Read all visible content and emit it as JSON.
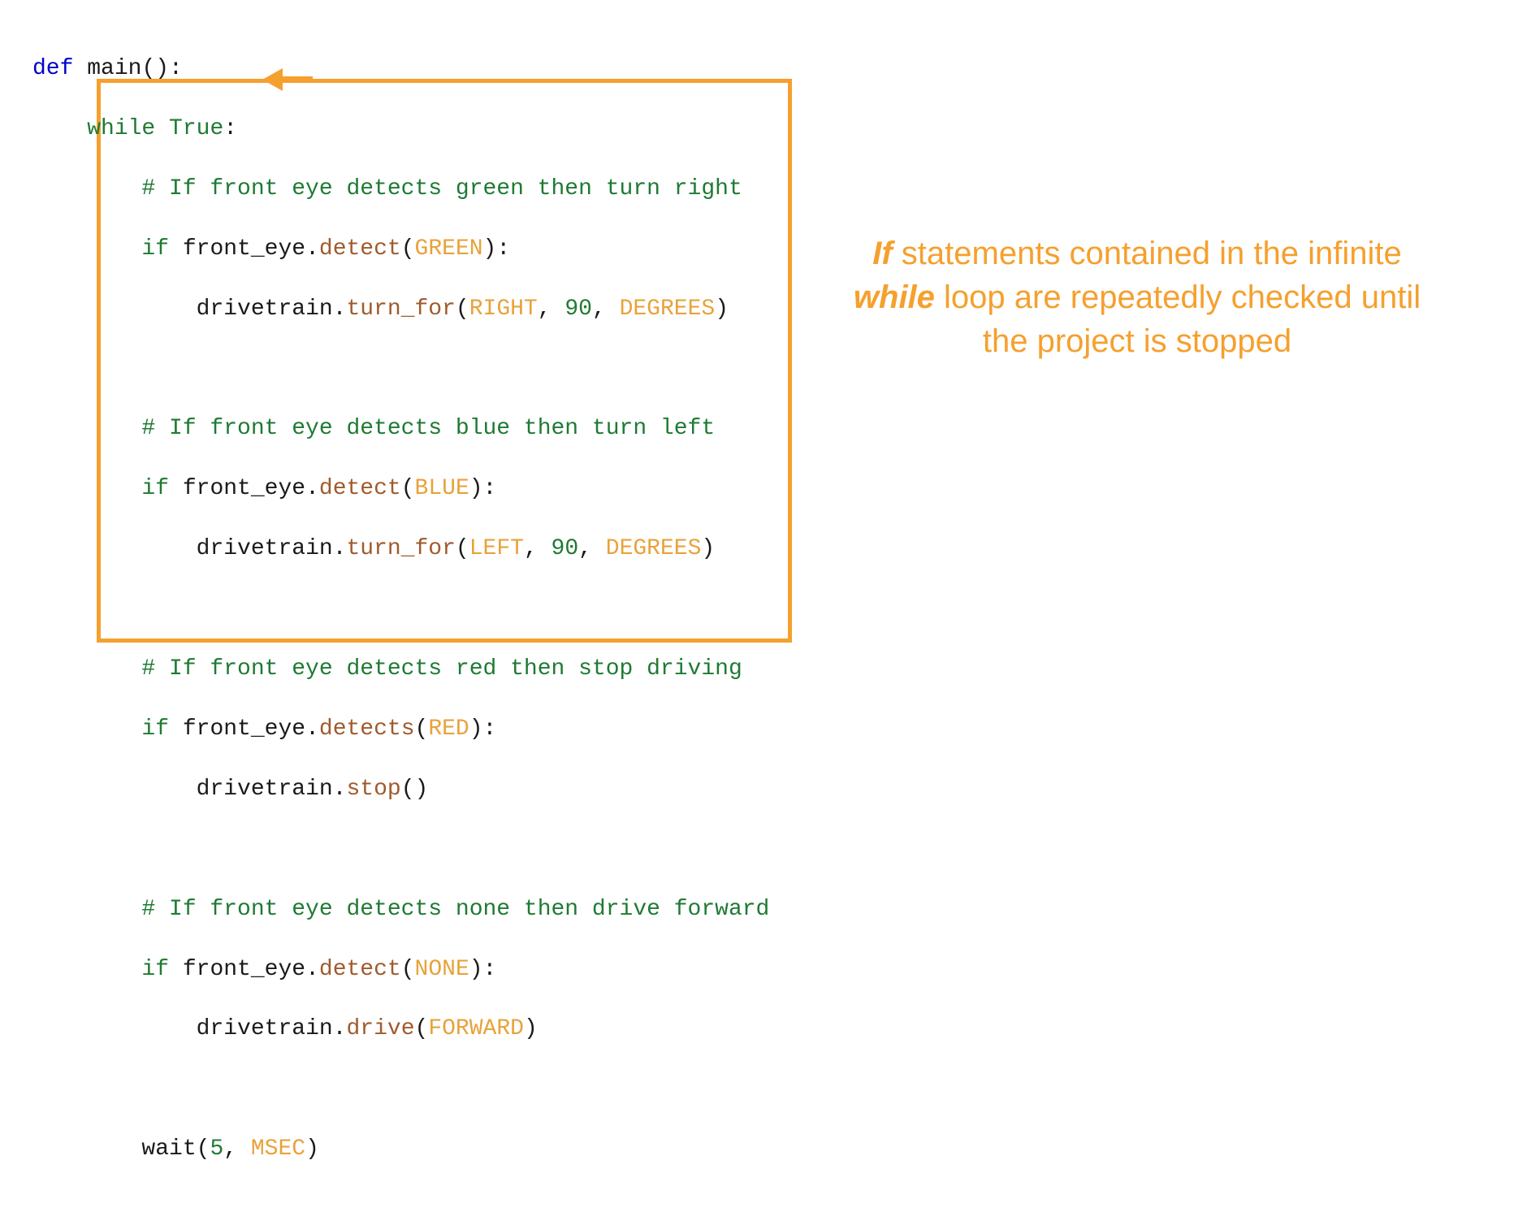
{
  "code": {
    "line_def": {
      "kw": "def",
      "name": "main",
      "parens": "():",
      "space": " "
    },
    "line_while": {
      "kw": "while",
      "true": "True",
      "colon": ":"
    },
    "comment_green": "# If front eye detects green then turn right",
    "if_green": {
      "kw": "if",
      "obj": "front_eye",
      "dot": ".",
      "method": "detect",
      "open": "(",
      "arg": "GREEN",
      "close": "):"
    },
    "turn_right": {
      "obj": "drivetrain",
      "dot": ".",
      "method": "turn_for",
      "open": "(",
      "a1": "RIGHT",
      "c1": ", ",
      "a2": "90",
      "c2": ", ",
      "a3": "DEGREES",
      "close": ")"
    },
    "comment_blue": "# If front eye detects blue then turn left",
    "if_blue": {
      "kw": "if",
      "obj": "front_eye",
      "dot": ".",
      "method": "detect",
      "open": "(",
      "arg": "BLUE",
      "close": "):"
    },
    "turn_left": {
      "obj": "drivetrain",
      "dot": ".",
      "method": "turn_for",
      "open": "(",
      "a1": "LEFT",
      "c1": ", ",
      "a2": "90",
      "c2": ", ",
      "a3": "DEGREES",
      "close": ")"
    },
    "comment_red": "# If front eye detects red then stop driving",
    "if_red": {
      "kw": "if",
      "obj": "front_eye",
      "dot": ".",
      "method": "detects",
      "open": "(",
      "arg": "RED",
      "close": "):"
    },
    "stop": {
      "obj": "drivetrain",
      "dot": ".",
      "method": "stop",
      "parens": "()"
    },
    "comment_none": "# If front eye detects none then drive forward",
    "if_none": {
      "kw": "if",
      "obj": "front_eye",
      "dot": ".",
      "method": "detect",
      "open": "(",
      "arg": "NONE",
      "close": "):"
    },
    "drive": {
      "obj": "drivetrain",
      "dot": ".",
      "method": "drive",
      "open": "(",
      "arg": "FORWARD",
      "close": ")"
    },
    "wait": {
      "fn": "wait",
      "open": "(",
      "a1": "5",
      "c1": ", ",
      "a2": "MSEC",
      "close": ")"
    }
  },
  "annotation": {
    "part1a": "If",
    "part1b": " statements contained in the infinite ",
    "part1c": "while",
    "part1d": " loop are repeatedly checked until the project is stopped"
  },
  "colors": {
    "accent": "#f5a02e",
    "keyword_def": "#0000cc",
    "keyword_green": "#1f7a33",
    "method_brown": "#a05a2c",
    "const_orange": "#e8a23a"
  }
}
